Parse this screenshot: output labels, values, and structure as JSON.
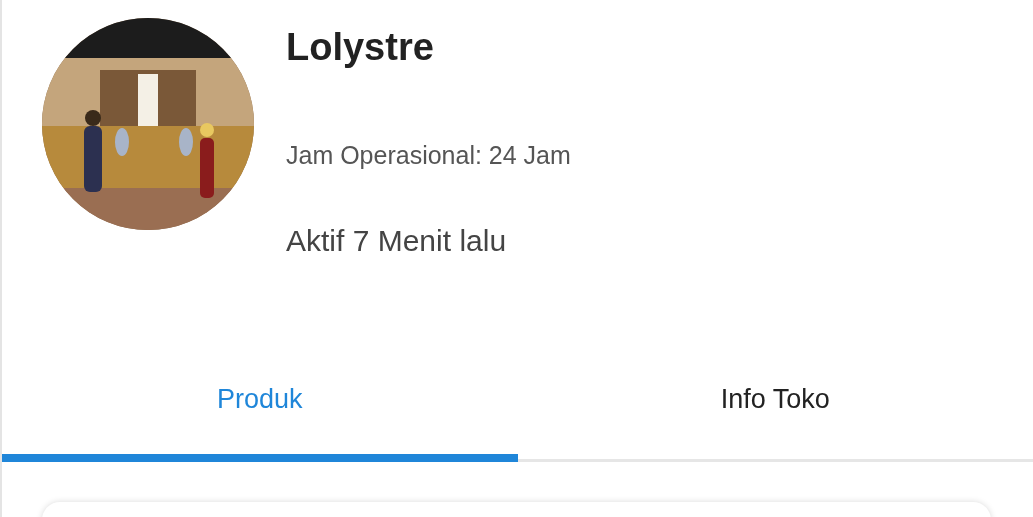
{
  "shop": {
    "name": "Lolystre",
    "hours": "Jam Operasional: 24 Jam",
    "last_active": "Aktif 7 Menit lalu"
  },
  "tabs": [
    {
      "label": "Produk",
      "selected": true
    },
    {
      "label": "Info Toko",
      "selected": false
    }
  ]
}
